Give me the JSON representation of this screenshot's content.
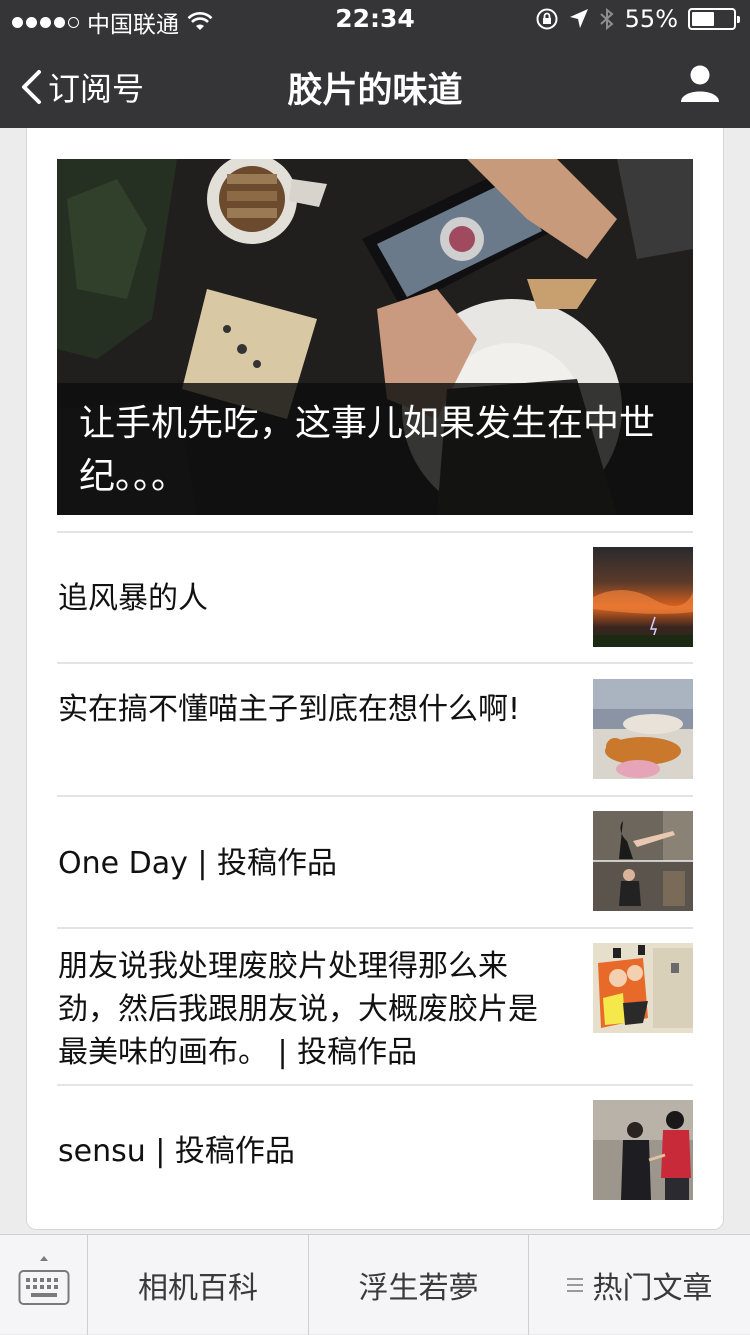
{
  "status_bar": {
    "carrier": "中国联通",
    "time": "22:34",
    "battery": "55%"
  },
  "nav": {
    "back_label": "订阅号",
    "title": "胶片的味道"
  },
  "hero": {
    "title": "让手机先吃，这事儿如果发生在中世纪。。。"
  },
  "articles": [
    {
      "title": "追风暴的人"
    },
    {
      "title": "实在搞不懂喵主子到底在想什么啊!"
    },
    {
      "title": "One Day | 投稿作品"
    },
    {
      "title": "朋友说我处理废胶片处理得那么来劲，然后我跟朋友说，大概废胶片是最美味的画布。 | 投稿作品"
    },
    {
      "title": "sensu | 投稿作品"
    }
  ],
  "bottom_menu": {
    "tabs": [
      {
        "label": "相机百科"
      },
      {
        "label": "浮生若夢"
      },
      {
        "label": "热门文章"
      }
    ]
  }
}
